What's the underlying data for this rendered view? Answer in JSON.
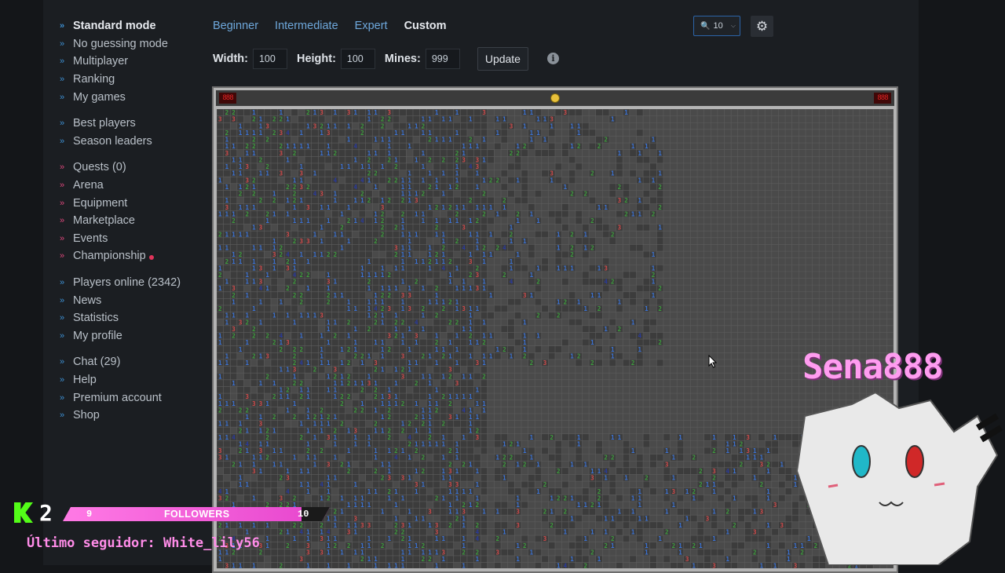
{
  "sidebar": {
    "groups": [
      [
        {
          "label": "Standard mode",
          "active": true
        },
        {
          "label": "No guessing mode"
        },
        {
          "label": "Multiplayer"
        },
        {
          "label": "Ranking"
        },
        {
          "label": "My games"
        }
      ],
      [
        {
          "label": "Best players"
        },
        {
          "label": "Season leaders"
        }
      ],
      [
        {
          "label": "Quests (0)",
          "pink": true
        },
        {
          "label": "Arena",
          "pink": true
        },
        {
          "label": "Equipment",
          "pink": true
        },
        {
          "label": "Marketplace",
          "pink": true
        },
        {
          "label": "Events",
          "pink": true
        },
        {
          "label": "Championship",
          "pink": true,
          "dot": true
        }
      ],
      [
        {
          "label": "Players online (2342)"
        },
        {
          "label": "News"
        },
        {
          "label": "Statistics"
        },
        {
          "label": "My profile"
        }
      ],
      [
        {
          "label": "Chat (29)"
        },
        {
          "label": "Help"
        },
        {
          "label": "Premium account"
        },
        {
          "label": "Shop"
        }
      ]
    ]
  },
  "difficulty_tabs": {
    "beginner": "Beginner",
    "intermediate": "Intermediate",
    "expert": "Expert",
    "custom": "Custom",
    "selected": "custom"
  },
  "zoom": {
    "value": "10",
    "icon": "magnifier-icon"
  },
  "settings": {
    "icon": "gear-icon"
  },
  "params": {
    "width_label": "Width:",
    "width_value": "100",
    "height_label": "Height:",
    "height_value": "100",
    "mines_label": "Mines:",
    "mines_value": "999",
    "update_label": "Update",
    "info_icon": "info-icon"
  },
  "board": {
    "mines_counter": "888",
    "timer": "888",
    "face": "smiley-icon",
    "number_colors": {
      "1": "#3b73d6",
      "2": "#3c9e3c",
      "3": "#d14a4a",
      "4": "#2a3a9a"
    }
  },
  "overlay": {
    "kick_count": "2",
    "followers_current": "9",
    "followers_label": "FOLLOWERS",
    "followers_goal": "10",
    "followers_progress": 0.9,
    "last_follower": "Último seguidor: White_lily56",
    "streamer_name": "Sena888"
  }
}
